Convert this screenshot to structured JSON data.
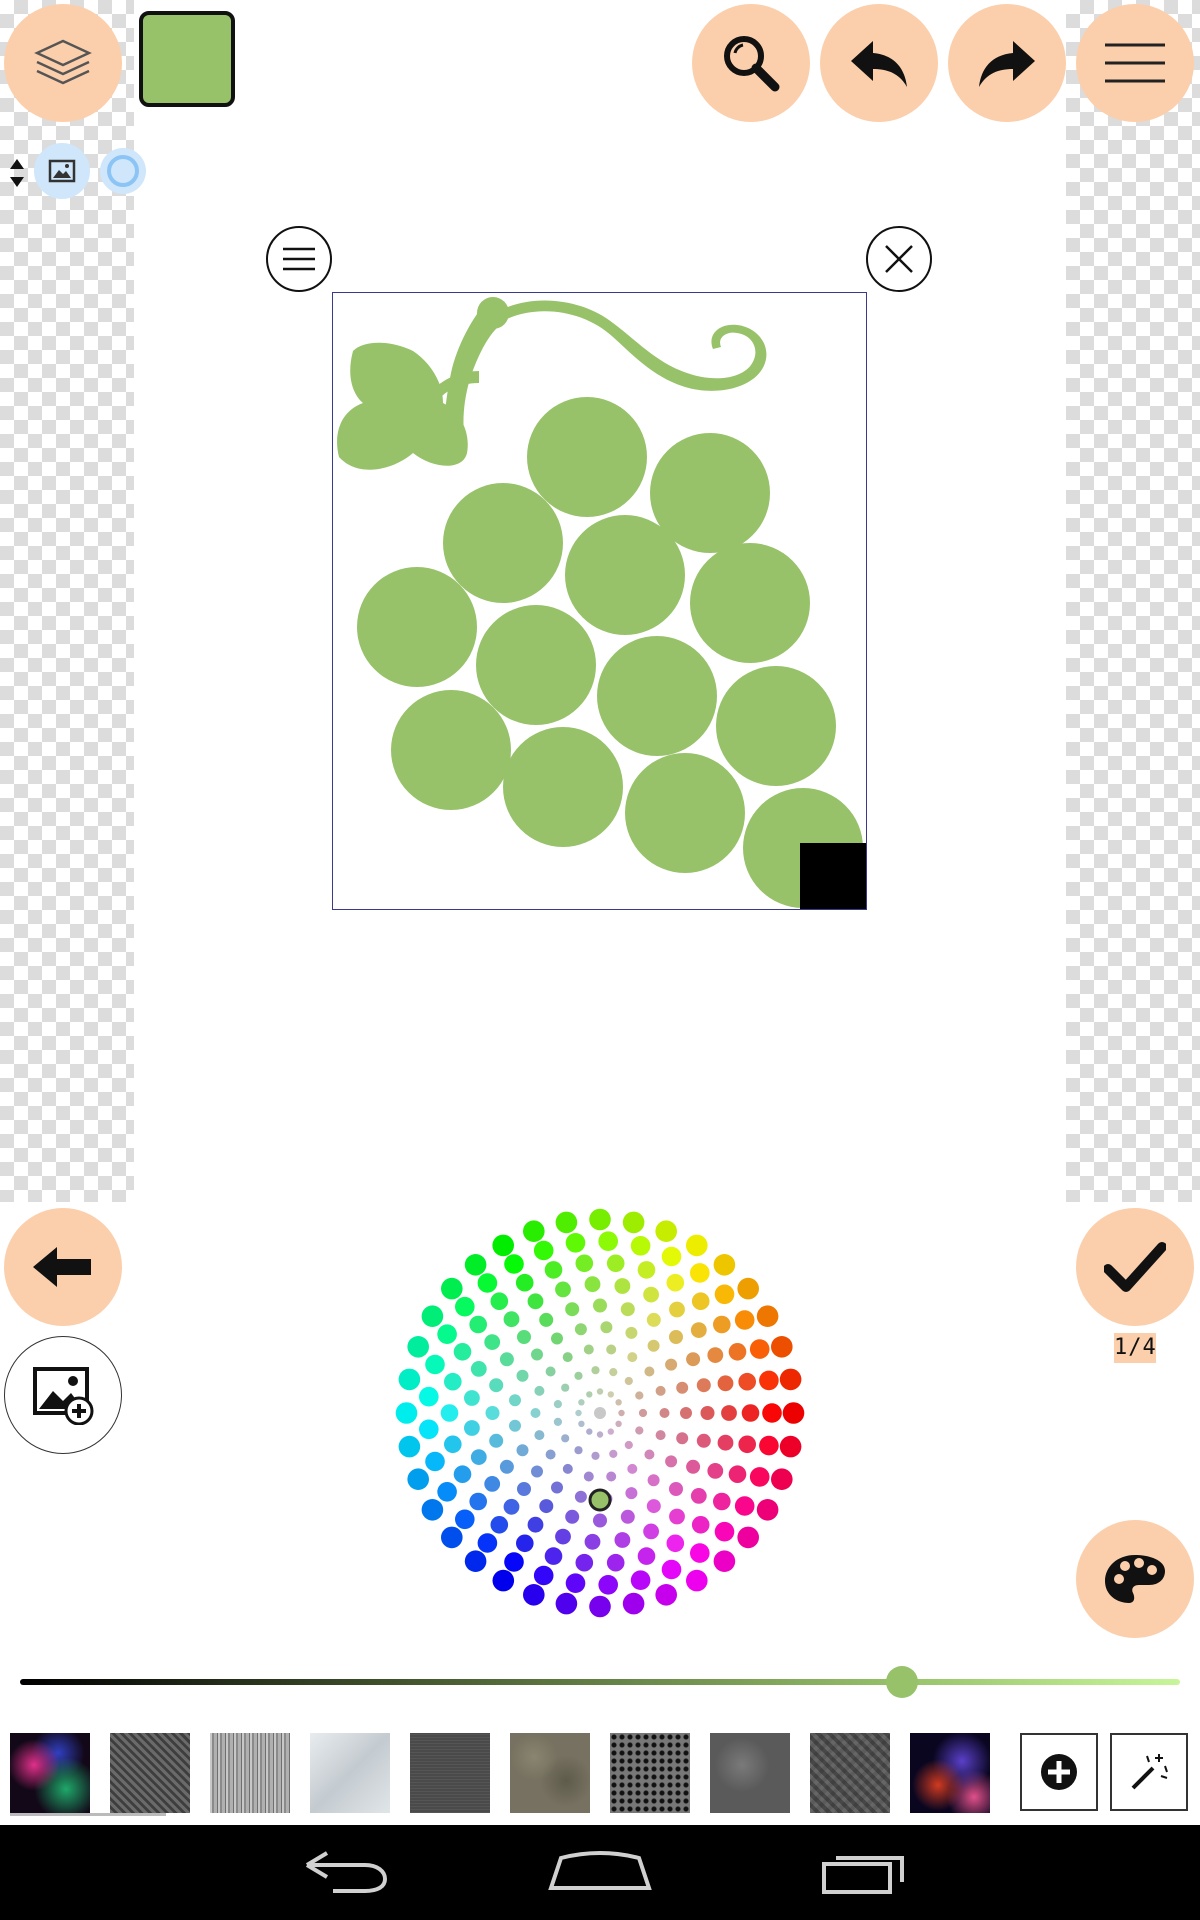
{
  "app": {
    "current_color": "#97c26a",
    "accent_color": "#fbcfac",
    "page_indicator": "1/4"
  },
  "toolbar": {
    "left": [
      {
        "name": "layers-icon"
      },
      {
        "name": "current-color-swatch"
      }
    ],
    "right": [
      {
        "name": "zoom-icon"
      },
      {
        "name": "undo-icon"
      },
      {
        "name": "redo-icon"
      },
      {
        "name": "menu-icon"
      }
    ]
  },
  "selection": {
    "menu_icon": "selection-menu-icon",
    "close_icon": "selection-close-icon",
    "resize_handle": "resize-handle"
  },
  "brightness_slider": {
    "value": 0.76,
    "start_color": "#000000",
    "end_color": "#c9f59a"
  },
  "textures": {
    "items": [
      {
        "name": "nebula-texture"
      },
      {
        "name": "chain-mail-texture"
      },
      {
        "name": "wood-grain-texture"
      },
      {
        "name": "brushed-metal-texture"
      },
      {
        "name": "dark-metal-texture"
      },
      {
        "name": "stone-texture"
      },
      {
        "name": "perforated-metal-texture"
      },
      {
        "name": "rough-metal-texture"
      },
      {
        "name": "diamond-plate-texture"
      },
      {
        "name": "galaxy-texture"
      }
    ]
  },
  "navbar": {
    "items": [
      {
        "name": "back-nav-icon"
      },
      {
        "name": "home-nav-icon"
      },
      {
        "name": "recents-nav-icon"
      }
    ]
  }
}
